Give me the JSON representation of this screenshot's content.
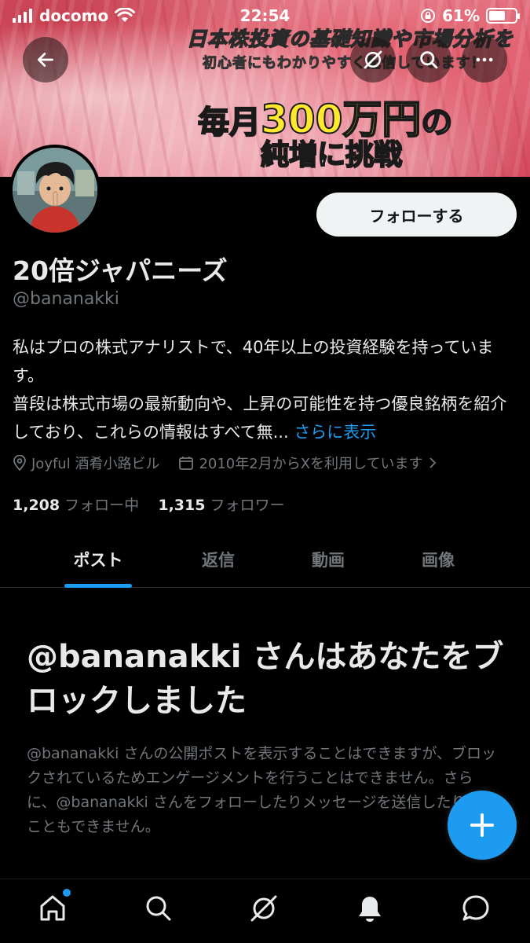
{
  "status_bar": {
    "carrier": "docomo",
    "time": "22:54",
    "battery": "61%",
    "battery_level": 0.61
  },
  "banner": {
    "line1": "日本株投資の基礎知識や市場分析を",
    "line2": "初心者にもわかりやすく配信しています！",
    "line3_prefix": "毎月",
    "line3_highlight": "300万円",
    "line3_suffix": "の",
    "line4": "純増に挑戦"
  },
  "profile": {
    "display_name": "20倍ジャパニーズ",
    "handle": "@bananakki",
    "follow_label": "フォローする",
    "bio_line1": "私はプロの株式アナリストで、40年以上の投資経験を持っています。",
    "bio_line2": "普段は株式市場の最新動向や、上昇の可能性を持つ優良銘柄を紹介しており、これらの情報はすべて無...",
    "bio_more": "さらに表示",
    "location": "Joyful 酒肴小路ビル",
    "joined": "2010年2月からXを利用しています",
    "following_count": "1,208",
    "following_label": "フォロー中",
    "followers_count": "1,315",
    "followers_label": "フォロワー"
  },
  "tabs": [
    {
      "label": "ポスト",
      "active": true
    },
    {
      "label": "返信",
      "active": false
    },
    {
      "label": "動画",
      "active": false
    },
    {
      "label": "画像",
      "active": false
    }
  ],
  "blocked": {
    "title": "@bananakki さんはあなたをブロックしました",
    "body": "@bananakki さんの公開ポストを表示することはできますが、ブロックされているためエンゲージメントを行うことはできません。さらに、@bananakki さんをフォローしたりメッセージを送信したりすることもできません。"
  },
  "colors": {
    "accent": "#1d9bf0",
    "background": "#000000",
    "secondary_text": "#71767b"
  },
  "icons": {
    "top_bar": [
      "back-arrow-icon",
      "grok-icon",
      "search-icon",
      "more-icon"
    ],
    "bottom_nav": [
      "home-icon",
      "search-icon",
      "grok-icon",
      "notifications-icon",
      "messages-icon"
    ]
  }
}
